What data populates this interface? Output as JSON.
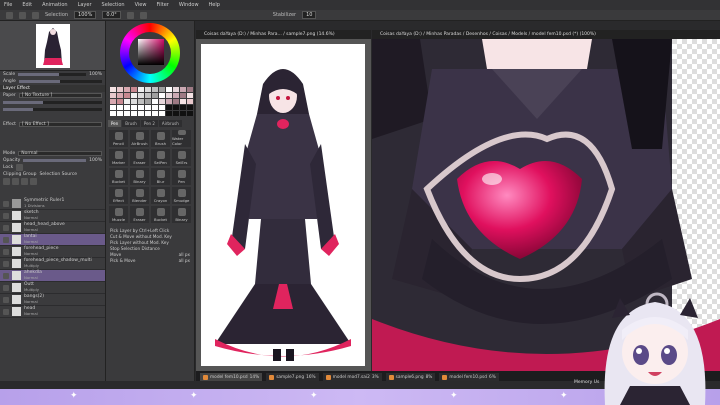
{
  "menubar": {
    "items": [
      "File",
      "Edit",
      "Animation",
      "Layer",
      "Selection",
      "View",
      "Filter",
      "Window",
      "Help"
    ]
  },
  "toolbar": {
    "selection_label": "Selection",
    "zoom": "100%",
    "angle": "0.0°",
    "stabilizer_label": "Stabilizer",
    "stabilizer_value": "10"
  },
  "navigator": {
    "scale_label": "Scale",
    "scale_value": "100%",
    "angle_label": "Angle"
  },
  "layer_effect": {
    "title": "Layer Effect",
    "paper_label": "Paper",
    "paper_value": "[ No Texture ]",
    "effect_label": "Effect",
    "effect_value": "[ No Effect ]"
  },
  "layer_props": {
    "mode_label": "Mode",
    "mode_value": "Normal",
    "opacity_label": "Opacity",
    "opacity_value": "100%",
    "lock_label": "Lock",
    "clipping_label": "Clipping Group",
    "selection_source_label": "Selection Source"
  },
  "layers": [
    {
      "name": "Symmetric Ruler1",
      "mode": "1 Divisions"
    },
    {
      "name": "sketch",
      "mode": "Normal"
    },
    {
      "name": "head_head_above",
      "mode": "Normal"
    },
    {
      "name": "lantai",
      "mode": "Normal"
    },
    {
      "name": "forehead_piece",
      "mode": "Normal"
    },
    {
      "name": "forehead_piece_shadow_multi",
      "mode": "Multiply"
    },
    {
      "name": "ahekdla",
      "mode": "Normal"
    },
    {
      "name": "Outt",
      "mode": "Multiply"
    },
    {
      "name": "bangs(2)",
      "mode": "Normal"
    },
    {
      "name": "head",
      "mode": "Normal"
    }
  ],
  "tool_tabs": [
    "Pen",
    "Brush",
    "Pen 2",
    "Airbrush"
  ],
  "tools": [
    "Pencil",
    "AirBrush",
    "Brush",
    "Water Color",
    "Marker",
    "Eraser",
    "SelPen",
    "SelErs",
    "Bucket",
    "Binary",
    "Blur",
    "Pen",
    "Effect",
    "Blender",
    "Crayon",
    "Smudge",
    "Muzzle",
    "Eraser",
    "Bucket",
    "Binary"
  ],
  "options": {
    "pick_layer": "Pick Layer by Ctrl+Left Click",
    "cut_ctrl": "Cut & Move without Mod. Key",
    "pick_layer2": "Pick Layer without Mod. Key",
    "stop_label": "Stop Selection Distance",
    "move_label": "Move",
    "move_value": "all px",
    "pick_move_label": "Pick & Move",
    "pick_move_value": "all px"
  },
  "docs": {
    "left_title": "Coisas daYaya (D:) / Minhas Para... / sample7.png (14.6%)",
    "right_title": "Coisas daYaya (D:) / Minhas Paradas / Desenhos / Coisas / Models / model fem10.psd (*) (100%)"
  },
  "taskbar": [
    {
      "name": "model fem10.psd",
      "pct": "14%"
    },
    {
      "name": "sample7.png",
      "pct": "16%"
    },
    {
      "name": "model mod7.sai2",
      "pct": "3%"
    },
    {
      "name": "sample6.png",
      "pct": "8%"
    },
    {
      "name": "model fem10.psd",
      "pct": "6%"
    }
  ],
  "memory_label": "Memory Us",
  "colors": {
    "accent": "#d40a6a",
    "panel": "#3b3b3d",
    "selected_layer": "#6a5a8a",
    "purple_bar": "#b7a0ea"
  }
}
